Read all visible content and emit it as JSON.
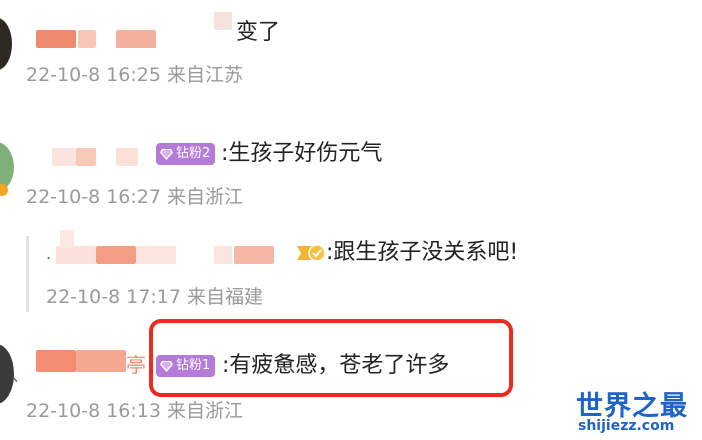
{
  "comments": [
    {
      "text": "变了",
      "timestamp": "22-10-8 16:25 来自江苏"
    },
    {
      "badge": "钻粉2",
      "text": ":生孩子好伤元气",
      "timestamp": "22-10-8 16:27 来自浙江",
      "reply": {
        "text": ":跟生孩子没关系吧!",
        "timestamp": "22-10-8 17:17 来自福建"
      }
    },
    {
      "name_suffix": "亭",
      "badge": "钻粉1",
      "text": ":有疲惫感，苍老了许多",
      "timestamp": "22-10-8 16:13 来自浙江"
    }
  ],
  "watermark": {
    "title": "世界之最",
    "url": "shijiezz.com"
  },
  "colors": {
    "badge_purple": "#b57bd8",
    "highlight_red": "#ee2a1e",
    "watermark_blue": "#1e63c8",
    "meta_gray": "#9a9a9a"
  },
  "icons": [
    "diamond-fan-badge-icon",
    "verified-badge-icon"
  ]
}
